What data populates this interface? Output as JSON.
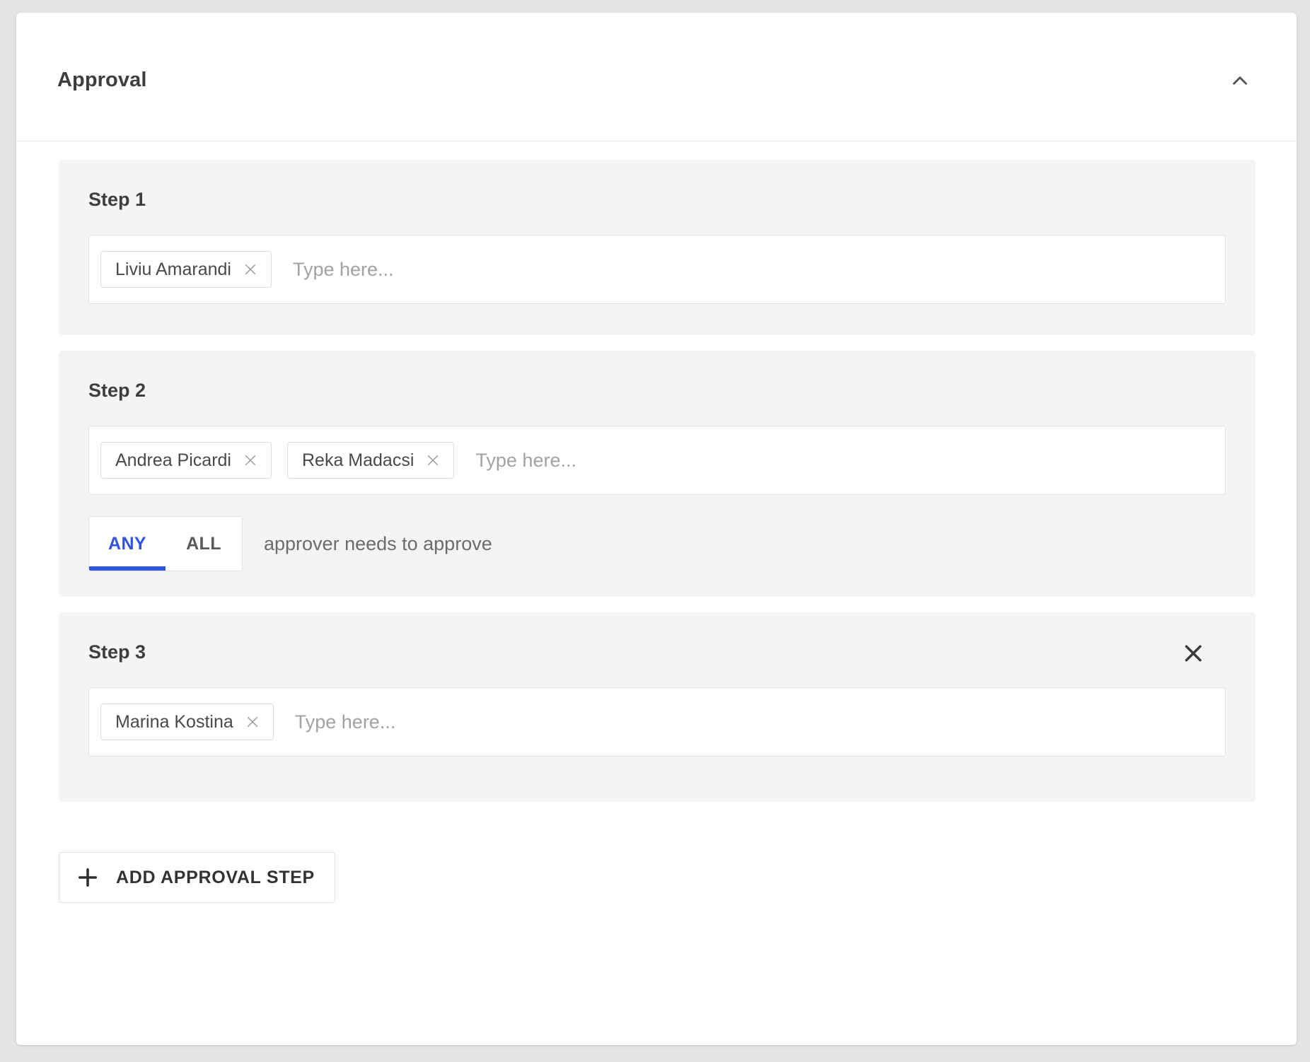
{
  "panel": {
    "title": "Approval",
    "collapse_icon": "chevron-up-icon",
    "collapsed": false
  },
  "steps": [
    {
      "title": "Step 1",
      "removable": false,
      "input": {
        "placeholder": "Type here...",
        "value": ""
      },
      "approvers": [
        {
          "name": "Liviu Amarandi",
          "remove_icon": "close-icon"
        }
      ],
      "approval_rule": null
    },
    {
      "title": "Step 2",
      "removable": false,
      "input": {
        "placeholder": "Type here...",
        "value": ""
      },
      "approvers": [
        {
          "name": "Andrea Picardi",
          "remove_icon": "close-icon"
        },
        {
          "name": "Reka Madacsi",
          "remove_icon": "close-icon"
        }
      ],
      "approval_rule": {
        "options": [
          "ANY",
          "ALL"
        ],
        "selected": "ANY",
        "caption": "approver needs to approve"
      }
    },
    {
      "title": "Step 3",
      "removable": true,
      "remove_icon": "close-icon",
      "input": {
        "placeholder": "Type here...",
        "value": ""
      },
      "approvers": [
        {
          "name": "Marina Kostina",
          "remove_icon": "close-icon"
        }
      ],
      "approval_rule": null
    }
  ],
  "add_step": {
    "label": "ADD APPROVAL STEP",
    "icon": "plus-icon"
  },
  "colors": {
    "accent": "#2F54E0",
    "page_background": "#E4E4E4",
    "card_background": "#FFFFFF",
    "step_background": "#F4F4F4",
    "text_primary": "#3E3E3E",
    "text_muted": "#A2A2A2",
    "border": "#E0E0E0"
  }
}
